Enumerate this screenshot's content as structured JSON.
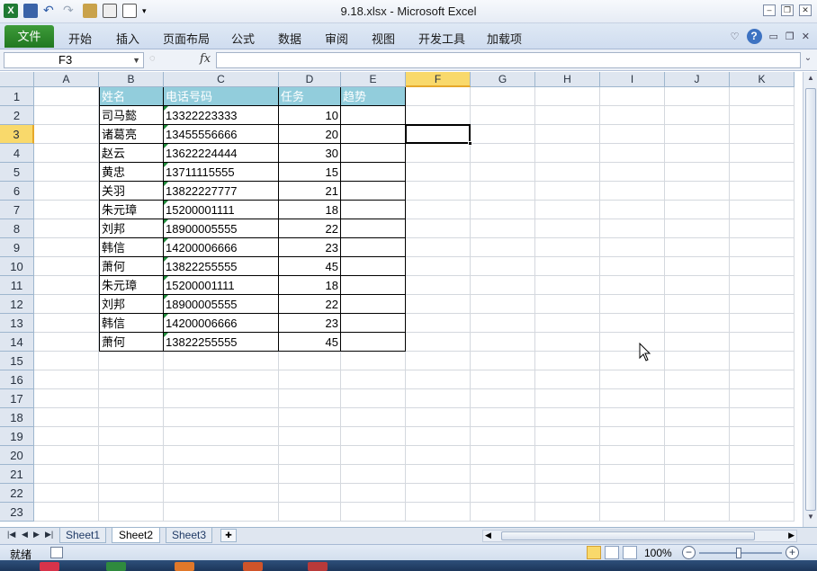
{
  "window": {
    "title": "9.18.xlsx - Microsoft Excel"
  },
  "ribbon": {
    "file_label": "文件",
    "tabs": [
      "开始",
      "插入",
      "页面布局",
      "公式",
      "数据",
      "审阅",
      "视图",
      "开发工具",
      "加载项"
    ]
  },
  "formula_bar": {
    "name_box": "F3",
    "fx_label": "fx",
    "value": ""
  },
  "grid": {
    "columns": [
      "A",
      "B",
      "C",
      "D",
      "E",
      "F",
      "G",
      "H",
      "I",
      "J",
      "K"
    ],
    "rows": [
      "1",
      "2",
      "3",
      "4",
      "5",
      "6",
      "7",
      "8",
      "9",
      "10",
      "11",
      "12",
      "13",
      "14",
      "15",
      "16",
      "17",
      "18",
      "19",
      "20",
      "21",
      "22",
      "23"
    ],
    "selected_column": "F",
    "selected_row": "3",
    "table_header": [
      "姓名",
      "电话号码",
      "任务",
      "趋势"
    ],
    "table_rows": [
      [
        "司马懿",
        "13322223333",
        "10",
        ""
      ],
      [
        "诸葛亮",
        "13455556666",
        "20",
        ""
      ],
      [
        "赵云",
        "13622224444",
        "30",
        ""
      ],
      [
        "黄忠",
        "13711115555",
        "15",
        ""
      ],
      [
        "关羽",
        "13822227777",
        "21",
        ""
      ],
      [
        "朱元璋",
        "15200001111",
        "18",
        ""
      ],
      [
        "刘邦",
        "18900005555",
        "22",
        ""
      ],
      [
        "韩信",
        "14200006666",
        "23",
        ""
      ],
      [
        "萧何",
        "13822255555",
        "45",
        ""
      ],
      [
        "朱元璋",
        "15200001111",
        "18",
        ""
      ],
      [
        "刘邦",
        "18900005555",
        "22",
        ""
      ],
      [
        "韩信",
        "14200006666",
        "23",
        ""
      ],
      [
        "萧何",
        "13822255555",
        "45",
        ""
      ]
    ]
  },
  "sheets": {
    "tabs": [
      "Sheet1",
      "Sheet2",
      "Sheet3"
    ],
    "active": "Sheet2"
  },
  "status": {
    "text": "就绪",
    "zoom": "100%"
  },
  "colors": {
    "header_fill": "#92cddc",
    "file_tab": "#2d8a2d",
    "selection_highlight": "#f9d96b"
  }
}
